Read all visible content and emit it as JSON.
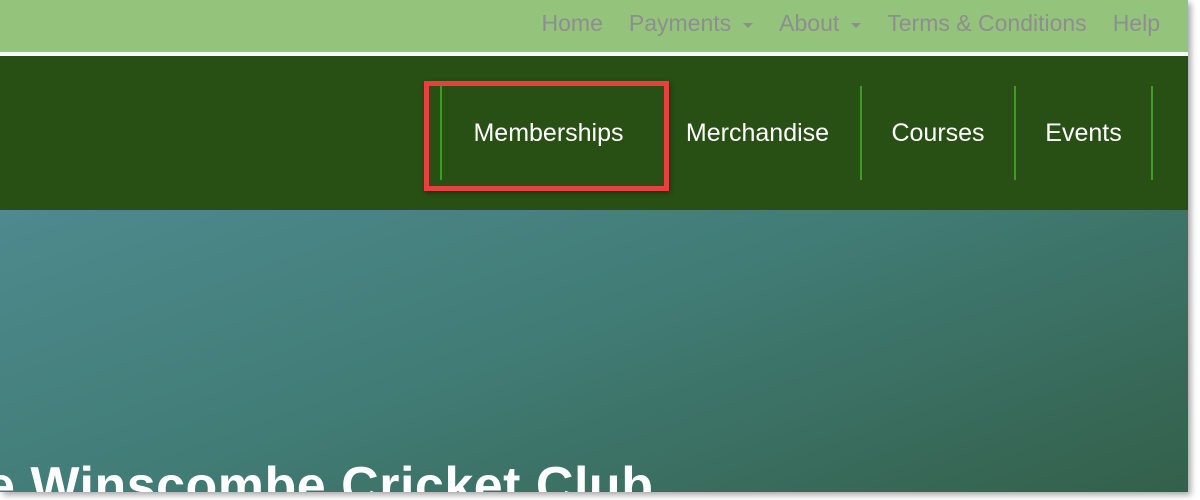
{
  "top_nav": {
    "items": [
      {
        "label": "Home",
        "has_dropdown": false
      },
      {
        "label": "Payments",
        "has_dropdown": true
      },
      {
        "label": "About",
        "has_dropdown": true
      },
      {
        "label": "Terms & Conditions",
        "has_dropdown": false
      },
      {
        "label": "Help",
        "has_dropdown": false
      }
    ]
  },
  "main_nav": {
    "items": [
      {
        "label": "Memberships",
        "highlighted": true
      },
      {
        "label": "Merchandise",
        "highlighted": false
      },
      {
        "label": "Courses",
        "highlighted": false
      },
      {
        "label": "Events",
        "highlighted": false
      }
    ]
  },
  "hero": {
    "title": "e Winscombe Cricket Club"
  },
  "colors": {
    "topbar_bg": "#94c47c",
    "mainbar_bg": "#284f14",
    "separator": "#3f9e22",
    "highlight": "#e8403f"
  }
}
